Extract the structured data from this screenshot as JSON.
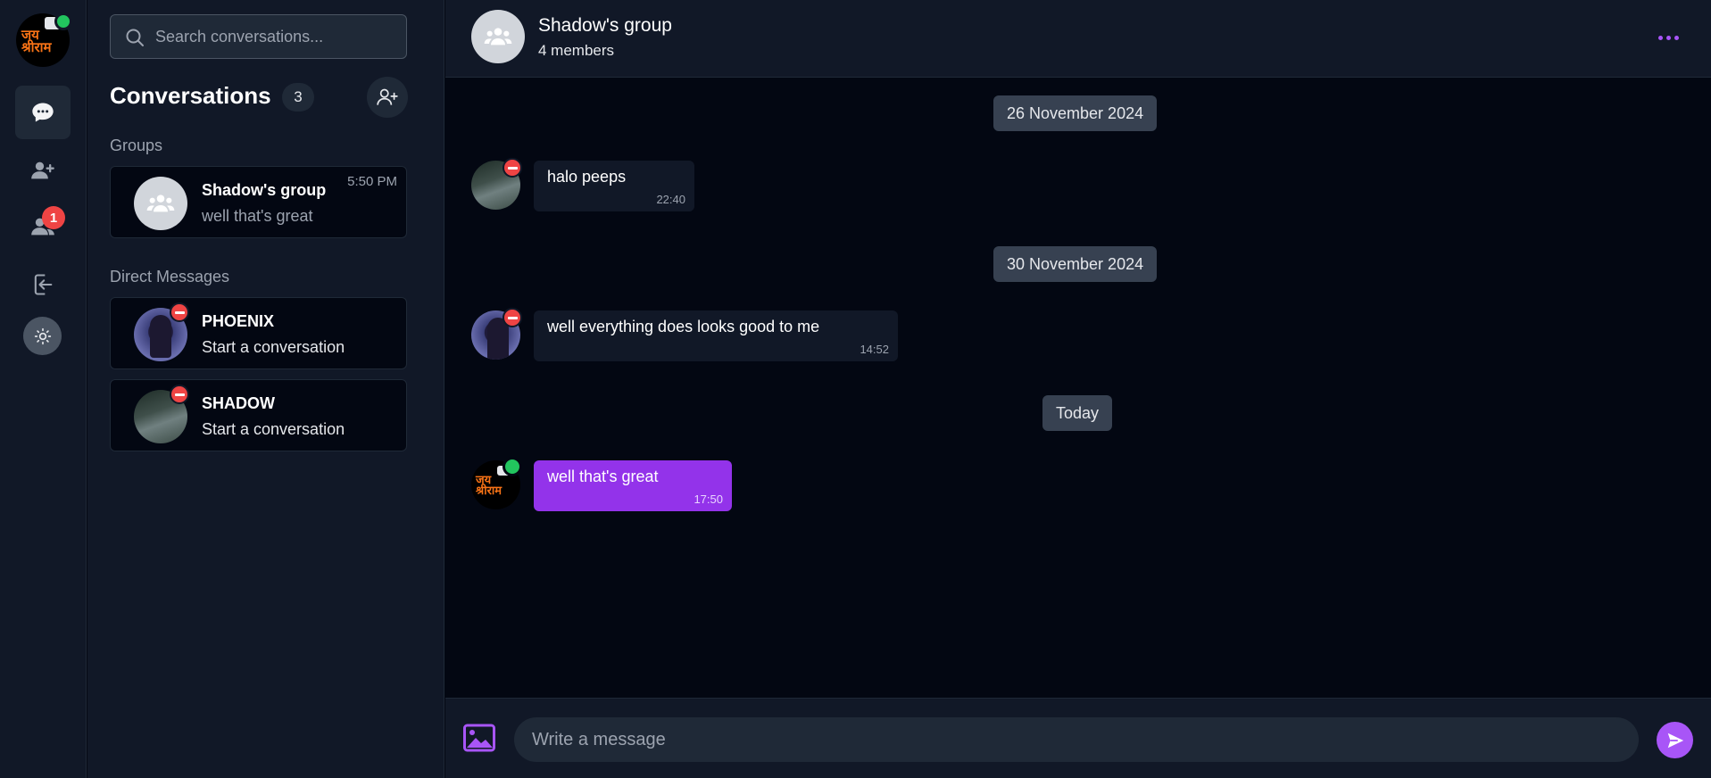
{
  "rail": {
    "nav_items": [
      "chat-icon",
      "add-friend-icon",
      "friends-icon",
      "logout-icon"
    ],
    "friend_requests_badge": "1",
    "theme_icon": "sun-icon",
    "user_logo_text_line1": "जय",
    "user_logo_text_line2": "श्रीराम"
  },
  "sidebar": {
    "search_placeholder": "Search conversations...",
    "title": "Conversations",
    "count": "3",
    "groups_label": "Groups",
    "direct_label": "Direct Messages",
    "groups": [
      {
        "name": "Shadow's group",
        "last_message": "well that's great",
        "time": "5:50 PM"
      }
    ],
    "direct": [
      {
        "name": "PHOENIX",
        "subtitle": "Start a conversation"
      },
      {
        "name": "SHADOW",
        "subtitle": "Start a conversation"
      }
    ]
  },
  "chat": {
    "name": "Shadow's group",
    "members": "4 members",
    "days": [
      {
        "date": "26 November 2024",
        "messages": [
          {
            "text": "halo peeps",
            "time": "22:40"
          }
        ]
      },
      {
        "date": "30 November 2024",
        "messages": [
          {
            "text": "well everything does looks good to me",
            "time": "14:52"
          }
        ]
      },
      {
        "date": "Today",
        "messages": [
          {
            "text": "well that's great",
            "time": "17:50"
          }
        ]
      }
    ]
  },
  "composer": {
    "placeholder": "Write a message"
  },
  "colors": {
    "accent": "#a855f7",
    "own_bubble": "#9333ea",
    "online": "#22c55e",
    "busy": "#ef4444",
    "background": "#030712",
    "panel": "#111827"
  }
}
